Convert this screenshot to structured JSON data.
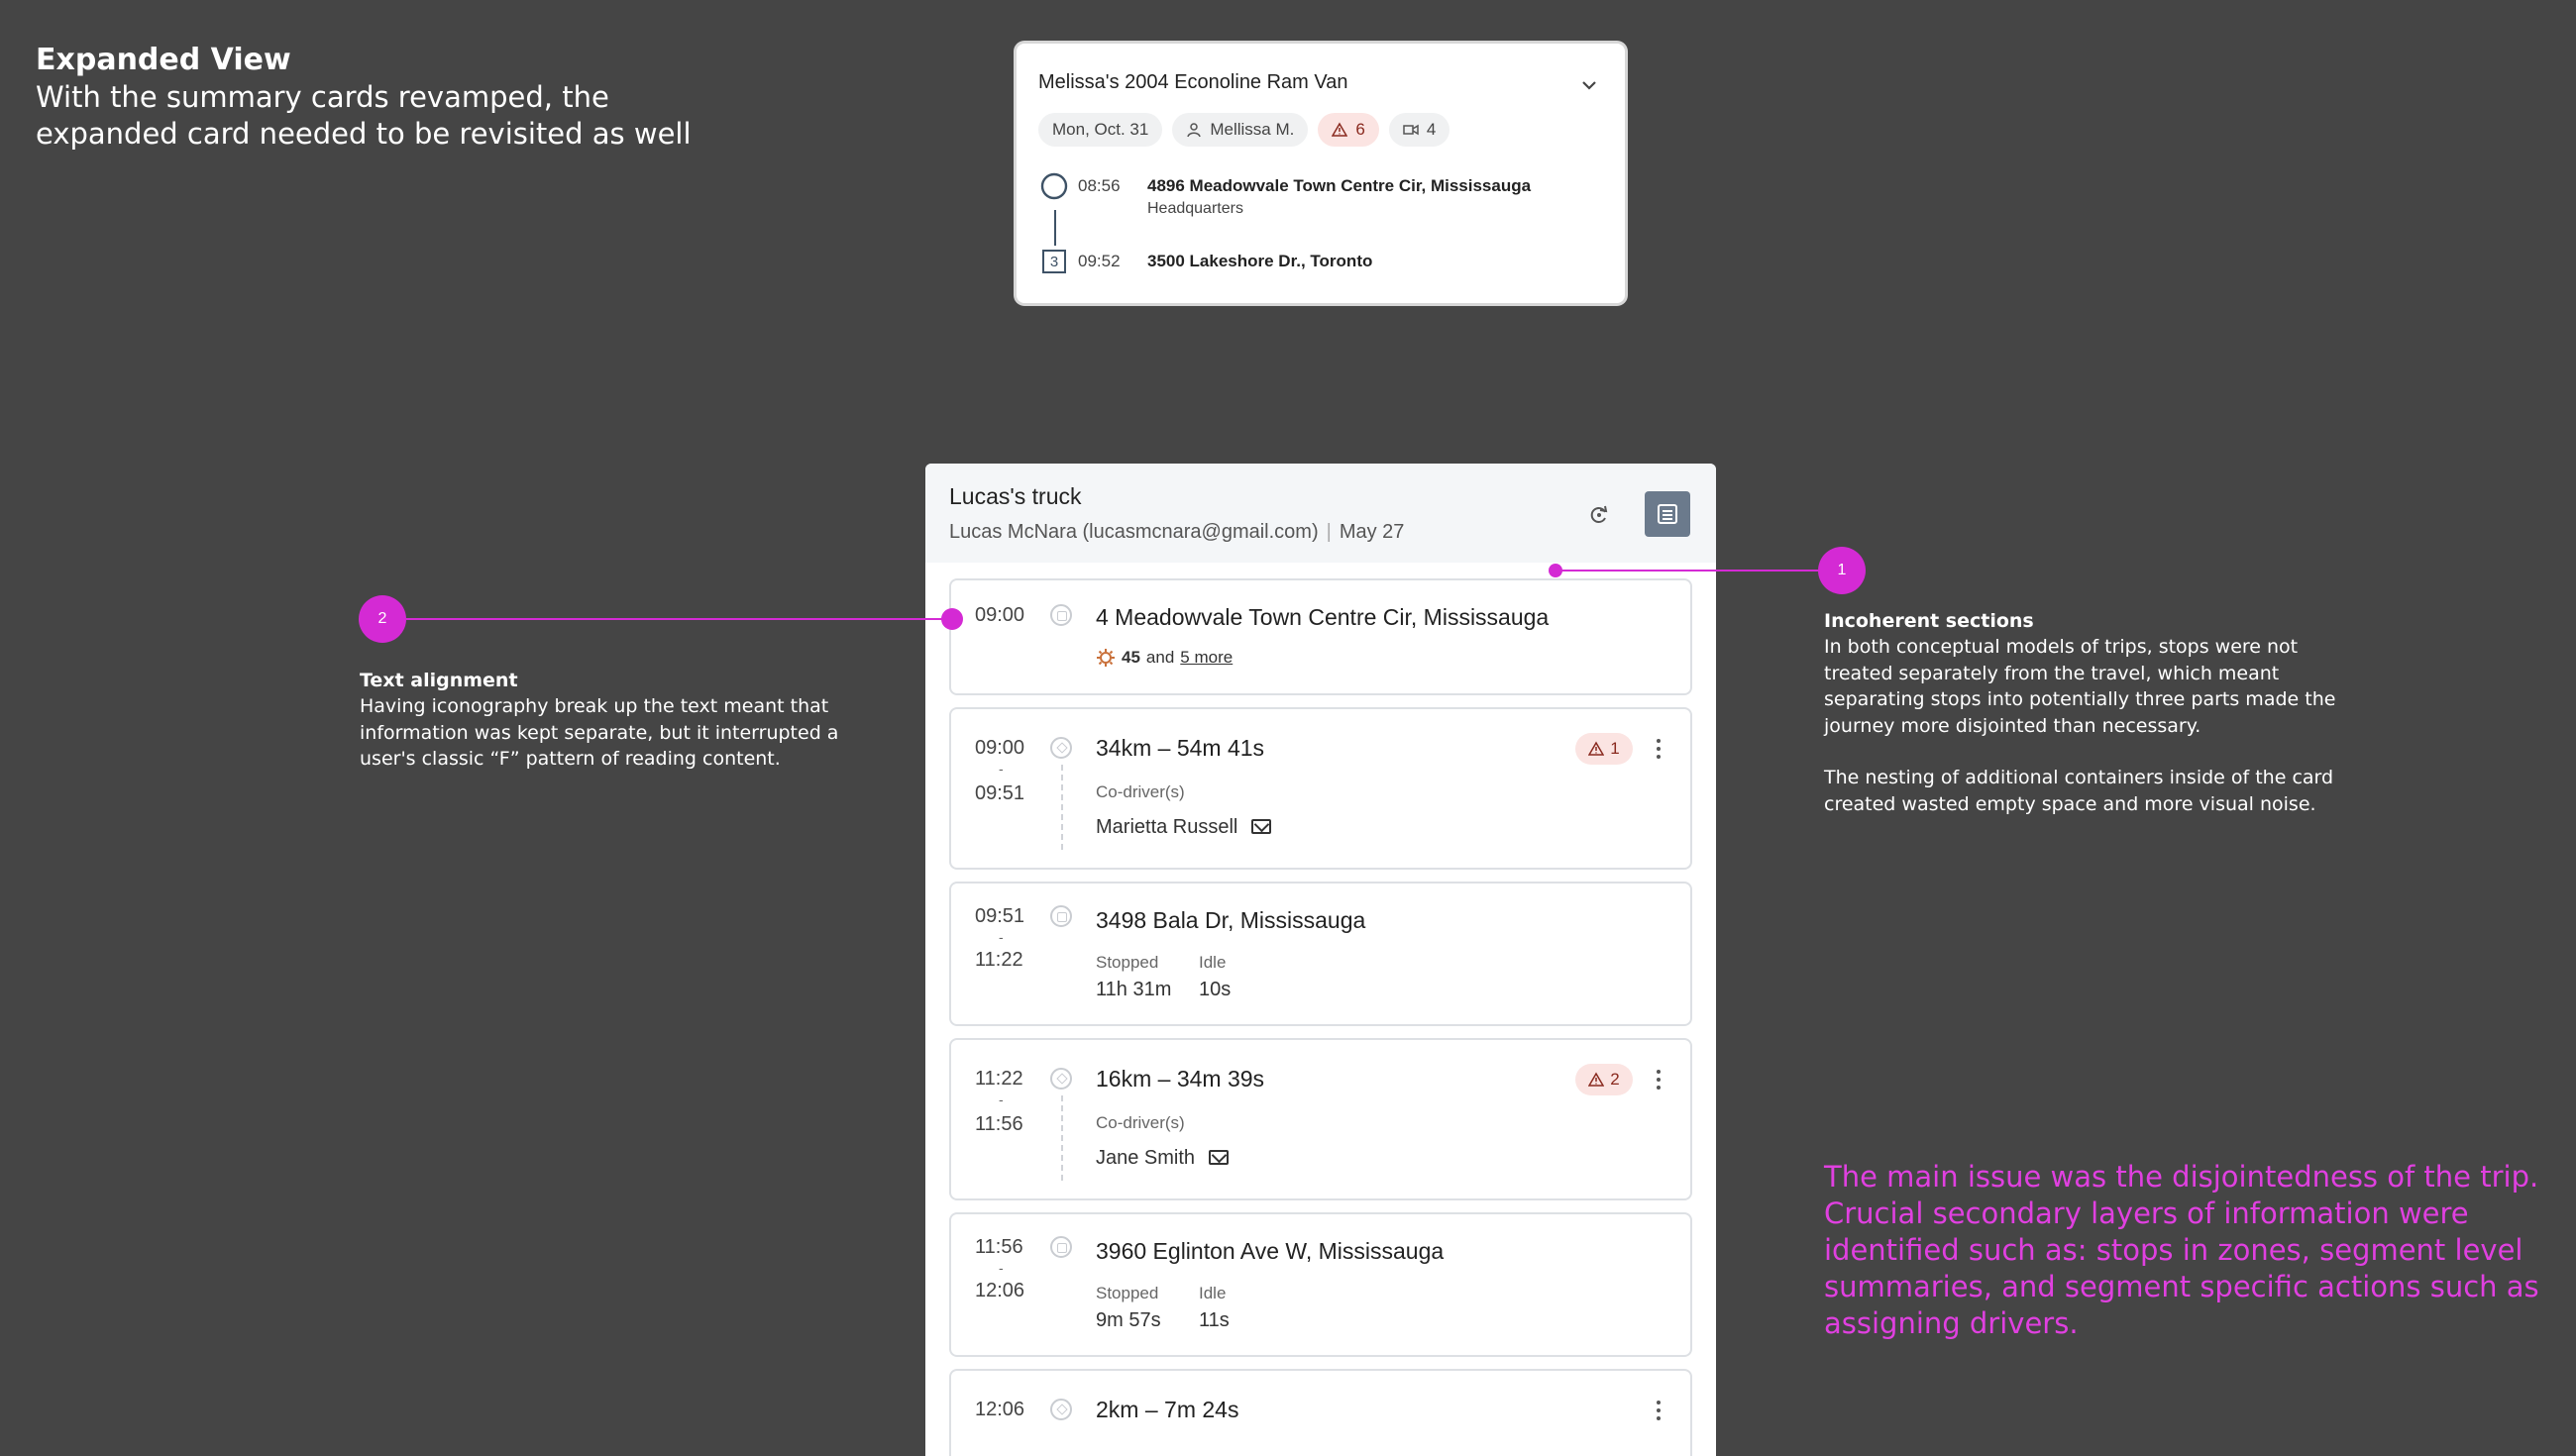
{
  "header": {
    "title": "Expanded View",
    "subtitle": "With the summary cards revamped, the expanded card needed to be revisited as well"
  },
  "summary_card": {
    "title": "Melissa's 2004 Econoline Ram Van",
    "chips": {
      "date": "Mon, Oct. 31",
      "driver": "Mellissa M.",
      "warnings": "6",
      "cameras": "4"
    },
    "stops": [
      {
        "time": "08:56",
        "address": "4896 Meadowvale Town Centre Cir, Mississauga",
        "sub": "Headquarters"
      },
      {
        "time": "09:52",
        "address": "3500 Lakeshore Dr., Toronto",
        "marker": "3"
      }
    ]
  },
  "expanded_card": {
    "title": "Lucas's truck",
    "driver": "Lucas McNara (lucasmcnara@gmail.com)",
    "date": "May 27",
    "segments": [
      {
        "type": "stop",
        "start": "09:00",
        "address": "4 Meadowvale Town Centre Cir, Mississauga",
        "count": "45",
        "and": "and",
        "more": "5 more"
      },
      {
        "type": "trip",
        "start": "09:00",
        "dash": "-",
        "end": "09:51",
        "summary": "34km – 54m 41s",
        "alerts": "1",
        "codriver_label": "Co-driver(s)",
        "codriver": "Marietta Russell"
      },
      {
        "type": "stop",
        "start": "09:51",
        "dash": "-",
        "end": "11:22",
        "address": "3498 Bala Dr, Mississauga",
        "stopped_label": "Stopped",
        "stopped": "11h 31m",
        "idle_label": "Idle",
        "idle": "10s"
      },
      {
        "type": "trip",
        "start": "11:22",
        "dash": "-",
        "end": "11:56",
        "summary": "16km – 34m 39s",
        "alerts": "2",
        "codriver_label": "Co-driver(s)",
        "codriver": "Jane Smith"
      },
      {
        "type": "stop",
        "start": "11:56",
        "dash": "-",
        "end": "12:06",
        "address": "3960 Eglinton Ave W, Mississauga",
        "stopped_label": "Stopped",
        "stopped": "9m 57s",
        "idle_label": "Idle",
        "idle": "11s"
      },
      {
        "type": "trip",
        "start": "12:06",
        "summary": "2km – 7m 24s"
      }
    ]
  },
  "callouts": {
    "one": {
      "number": "1",
      "title": "Incoherent sections",
      "p1": "In both conceptual models of trips, stops were not treated separately from the travel, which meant separating stops into potentially three parts made the journey more disjointed than necessary.",
      "p2": "The nesting of additional containers inside of the card created wasted empty space and more visual noise."
    },
    "two": {
      "number": "2",
      "title": "Text alignment",
      "p1": "Having iconography break up the text meant that information was kept separate, but it interrupted a user's classic “F” pattern of reading content."
    },
    "main_issue": "The main issue was the disjointedness of the trip. Crucial secondary layers of information were identified such as: stops in zones, segment level summaries, and segment specific actions such as assigning drivers."
  },
  "colors": {
    "background": "#454545",
    "accent": "#d42ad4",
    "button": "#6b7a8c",
    "warning_bg": "#fbe4e2"
  }
}
